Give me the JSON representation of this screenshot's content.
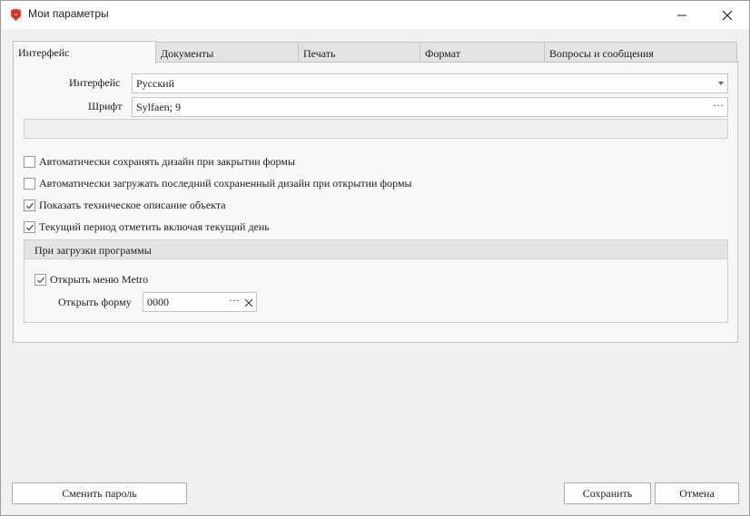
{
  "window": {
    "title": "Мои параметры"
  },
  "tabs": [
    {
      "label": "Интерфейс",
      "active": true
    },
    {
      "label": "Документы",
      "active": false
    },
    {
      "label": "Печать",
      "active": false
    },
    {
      "label": "Формат",
      "active": false
    },
    {
      "label": "Вопросы и сообщения",
      "active": false
    }
  ],
  "interface": {
    "interface_label": "Интерфейс",
    "interface_value": "Русский",
    "font_label": "Шрифт",
    "font_value": "Sylfaen; 9",
    "font_button": "···"
  },
  "checkboxes": [
    {
      "label": "Автоматически сохранять дизайн при закрытии формы",
      "checked": false
    },
    {
      "label": "Автоматически загружать последний сохраненный дизайн при открытии формы",
      "checked": false
    },
    {
      "label": "Показать техническое описание объекта",
      "checked": true
    },
    {
      "label": "Текущий период отметить включая текущий день",
      "checked": true
    }
  ],
  "startup": {
    "header": "При загрузки программы",
    "open_metro_label": "Открыть меню Metro",
    "open_metro_checked": true,
    "open_form_label": "Открыть форму",
    "open_form_value": "0000",
    "open_form_button": "···"
  },
  "footer": {
    "change_password": "Сменить пароль",
    "save": "Сохранить",
    "cancel": "Отмена"
  },
  "colors": {
    "app_icon": "#e2432f",
    "checkmark": "#555555"
  },
  "icons": {
    "app": "app-logo-icon",
    "minimize": "minimize-icon",
    "close": "close-icon",
    "clear": "clear-icon",
    "dropdown": "chevron-down-icon",
    "check": "check-icon"
  }
}
